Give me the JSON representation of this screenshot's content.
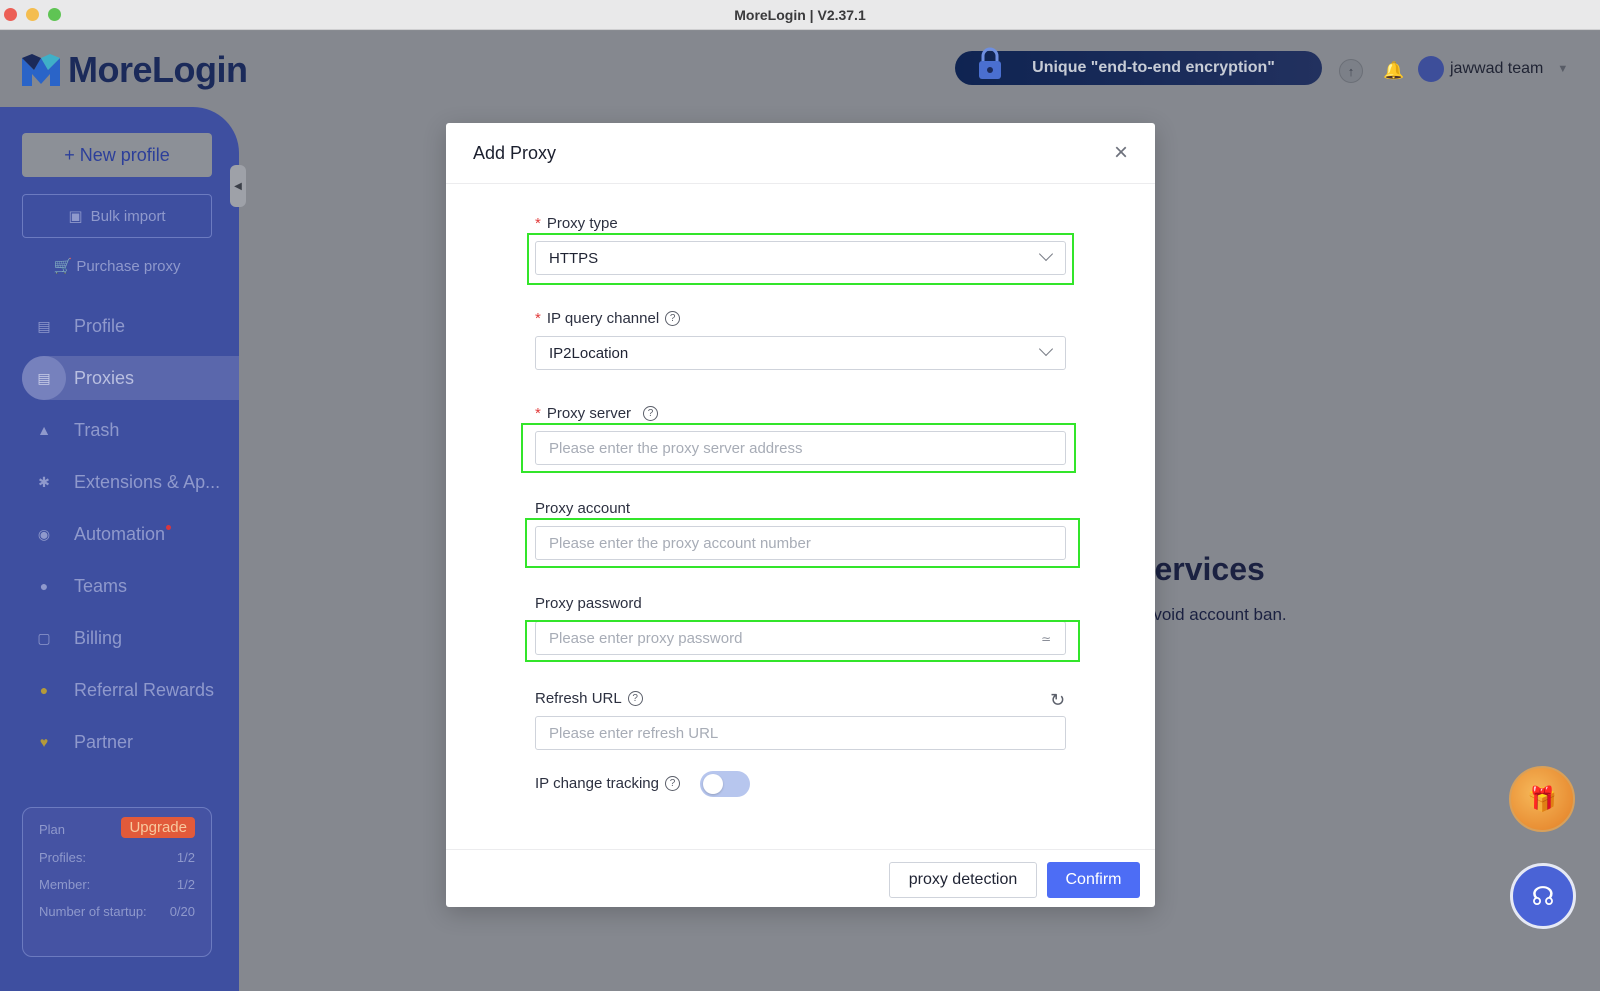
{
  "window": {
    "title": "MoreLogin | V2.37.1"
  },
  "header": {
    "logo_text": "MoreLogin",
    "banner_text": "Unique \"end-to-end encryption\"",
    "user_name": "jawwad team"
  },
  "sidebar": {
    "new_profile": "+ New profile",
    "bulk_import": "Bulk import",
    "purchase_proxy": "Purchase proxy",
    "items": [
      {
        "label": "Profile",
        "icon": "profile-icon"
      },
      {
        "label": "Proxies",
        "icon": "proxies-icon",
        "active": true
      },
      {
        "label": "Trash",
        "icon": "trash-icon"
      },
      {
        "label": "Extensions & Ap...",
        "icon": "puzzle-icon"
      },
      {
        "label": "Automation",
        "icon": "robot-icon",
        "badge": true
      },
      {
        "label": "Teams",
        "icon": "team-icon"
      },
      {
        "label": "Billing",
        "icon": "wallet-icon"
      },
      {
        "label": "Referral Rewards",
        "icon": "coin-icon"
      },
      {
        "label": "Partner",
        "icon": "heart-icon"
      }
    ],
    "plan": {
      "label": "Plan",
      "upgrade": "Upgrade",
      "profiles_label": "Profiles:",
      "profiles_value": "1/2",
      "member_label": "Member:",
      "member_value": "1/2",
      "startup_label": "Number of startup:",
      "startup_value": "0/20"
    }
  },
  "background": {
    "heading": "y services",
    "subtext": "to avoid account ban."
  },
  "modal": {
    "title": "Add Proxy",
    "proxy_type": {
      "label": "Proxy type",
      "value": "HTTPS"
    },
    "ip_query": {
      "label": "IP query channel",
      "value": "IP2Location"
    },
    "proxy_server": {
      "label": "Proxy server",
      "placeholder": "Please enter the proxy server address"
    },
    "proxy_account": {
      "label": "Proxy account",
      "placeholder": "Please enter the proxy account number"
    },
    "proxy_password": {
      "label": "Proxy password",
      "placeholder": "Please enter proxy password"
    },
    "refresh_url": {
      "label": "Refresh URL",
      "placeholder": "Please enter refresh URL"
    },
    "ip_change": {
      "label": "IP change tracking",
      "enabled": false
    },
    "detect_button": "proxy detection",
    "confirm_button": "Confirm"
  },
  "colors": {
    "sidebar": "#3e4fa0",
    "primary": "#4d6df5",
    "highlight": "#33e52a",
    "required": "#e23b3b"
  }
}
